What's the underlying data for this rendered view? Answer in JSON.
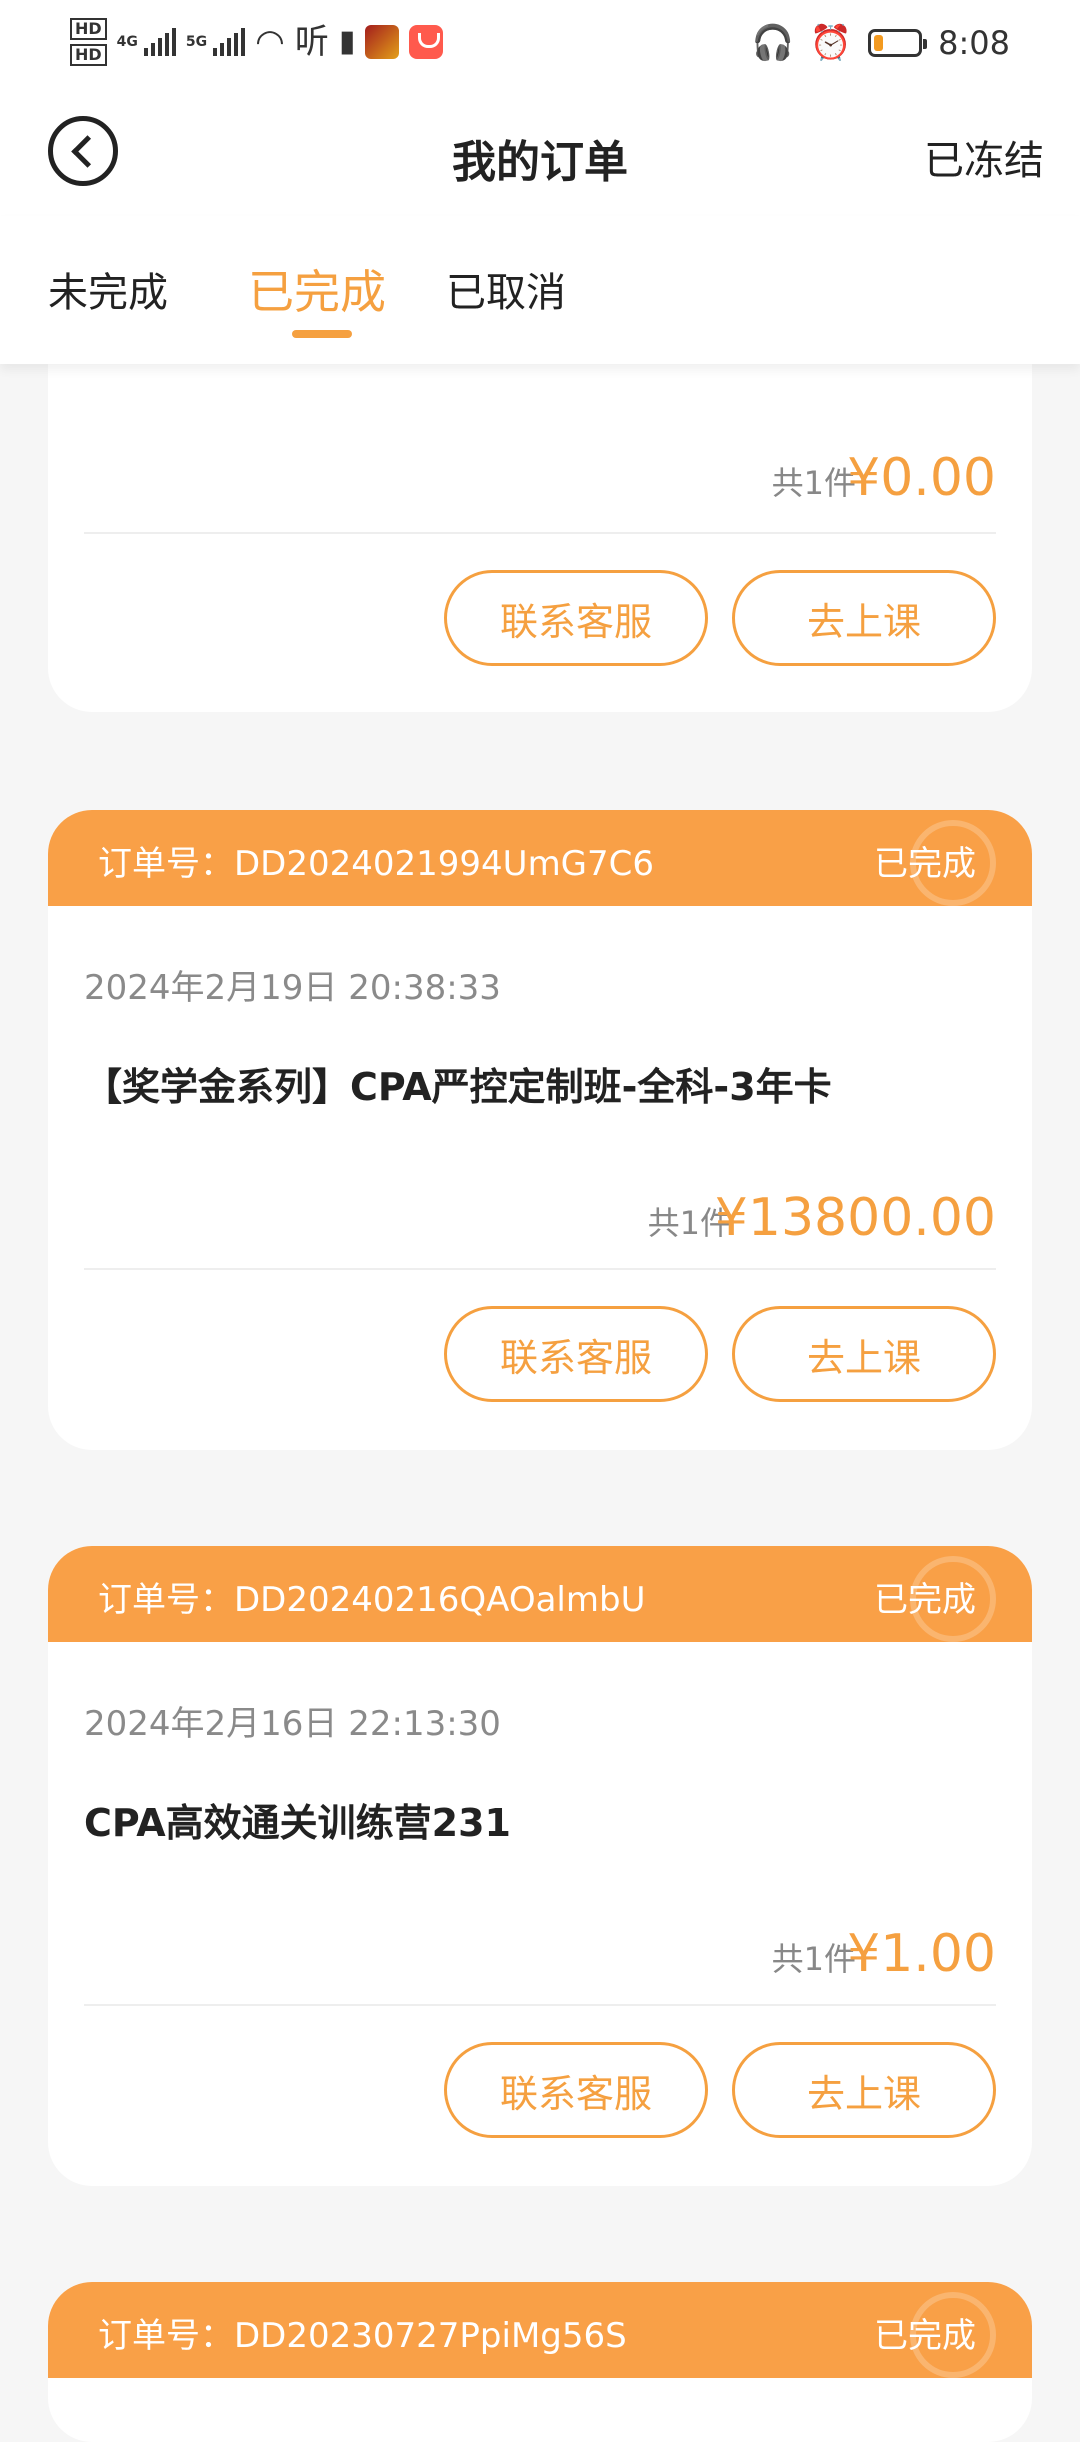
{
  "status_bar": {
    "net1": "4G",
    "net2": "5G",
    "ting": "听",
    "time": "8:08",
    "battery_level": 0.2
  },
  "header": {
    "title": "我的订单",
    "right_action": "已冻结"
  },
  "tabs": [
    {
      "label": "未完成"
    },
    {
      "label": "已完成"
    },
    {
      "label": "已取消"
    }
  ],
  "buttons": {
    "service": "联系客服",
    "go_class": "去上课"
  },
  "orders": [
    {
      "count": "共1件",
      "price": "¥0.00"
    },
    {
      "order_label": "订单号：DD2024021994UmG7C6",
      "status": "已完成",
      "date": "2024年2月19日 20:38:33",
      "name": "【奖学金系列】CPA严控定制班-全科-3年卡",
      "count": "共1件",
      "price": "¥13800.00"
    },
    {
      "order_label": "订单号：DD20240216QAOalmbU",
      "status": "已完成",
      "date": "2024年2月16日 22:13:30",
      "name": "CPA高效通关训练营231",
      "count": "共1件",
      "price": "¥1.00"
    },
    {
      "order_label": "订单号：DD20230727PpiMg56S",
      "status": "已完成"
    }
  ]
}
